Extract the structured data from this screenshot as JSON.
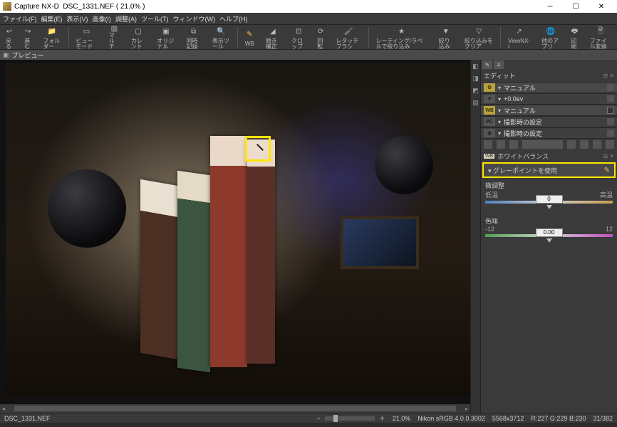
{
  "titlebar": {
    "app_name": "Capture NX-D",
    "file_name": "DSC_1331.NEF",
    "zoom_suffix": "( 21.0% )"
  },
  "menu": {
    "file": "ファイル(F)",
    "edit": "編集(E)",
    "view": "表示(V)",
    "image": "画像(I)",
    "adjust": "調整(A)",
    "tool": "ツール(T)",
    "window": "ウィンドウ(W)",
    "help": "ヘルプ(H)"
  },
  "toolbar": {
    "back": "戻る",
    "forward": "進む",
    "folder": "フォルダー",
    "viewmode": "ビューモード",
    "multi": "マルチ",
    "current": "カレント",
    "original": "オリジナル",
    "record": "同時記録",
    "displaytool": "表示ツール",
    "wb": "WB",
    "tiltfix": "傾き補正",
    "crop": "クロップ",
    "rotate": "回転",
    "retouch": "レタッチブラシ",
    "rating": "レーティング/ラベルで絞り込み",
    "filter": "絞り込み",
    "clearfilter": "絞り込みをクリア",
    "viewnxi": "ViewNX-i",
    "otherapp": "他のアプリ",
    "print": "印刷",
    "convert": "ファイル変換"
  },
  "preview_tab": "プレビュー",
  "edit_panel": {
    "title": "エディット",
    "rows": {
      "manual1": "マニュアル",
      "exposure": "+0.0ev",
      "manual2": "マニュアル",
      "shoot1": "撮影時の設定",
      "shoot2": "撮影時の設定"
    },
    "wb_section_title": "ホワイトバランス",
    "gray_point": "グレーポイントを使用",
    "slider1": {
      "label": "微調整",
      "left": "低温",
      "right": "高温",
      "value": "0"
    },
    "slider2": {
      "label": "色味",
      "left": "-12",
      "right": "12",
      "value": "0.00"
    }
  },
  "statusbar": {
    "filename": "DSC_1331.NEF",
    "zoom": "21.0%",
    "colorspace": "Nikon sRGB 4.0.0.3002",
    "dimensions": "5568x3712",
    "rgb": "R:227 G:229 B:230",
    "index": "31/382"
  }
}
